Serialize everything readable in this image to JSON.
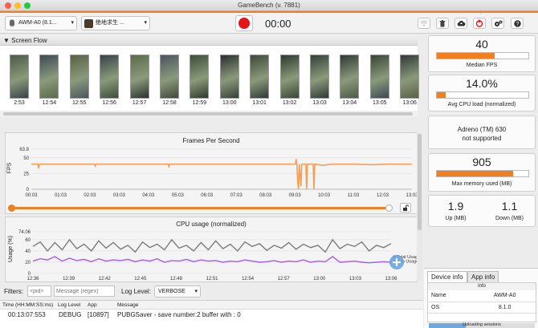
{
  "window": {
    "title": "GameBench (v. 7881)"
  },
  "toolbar": {
    "device": "AWM-A0 (8.1...",
    "app": "绝地求生 ...",
    "timer": "00:00"
  },
  "screen_flow": {
    "title": "Screen Flow",
    "times": [
      "2:53",
      "12:54",
      "12:55",
      "12:56",
      "12:57",
      "12:58",
      "12:59",
      "13:00",
      "13:01",
      "13:02",
      "13:03",
      "13:04",
      "13:05",
      "13:06"
    ]
  },
  "fps_chart": {
    "title": "Frames Per Second",
    "ylabel": "FPS"
  },
  "cpu_chart": {
    "title": "CPU usage (normalized)",
    "ylabel": "Usage (%)"
  },
  "chart_data": [
    {
      "type": "line",
      "title": "Frames Per Second",
      "ylabel": "FPS",
      "ylim": [
        0,
        63.8
      ],
      "yticks": [
        "63.8",
        "50",
        "25",
        "0"
      ],
      "xticks": [
        "00:03",
        "01:03",
        "02:03",
        "03:03",
        "04:03",
        "05:03",
        "06:03",
        "07:03",
        "08:03",
        "09:03",
        "10:03",
        "11:03",
        "12:03",
        "13:03"
      ],
      "series": [
        {
          "values": [
            [
              0,
              40
            ],
            [
              8,
              40
            ],
            [
              9,
              33
            ],
            [
              10,
              40
            ],
            [
              48,
              40
            ],
            [
              78,
              40
            ],
            [
              79,
              37
            ],
            [
              80,
              40
            ],
            [
              169,
              40
            ],
            [
              170,
              36
            ],
            [
              171,
              40
            ],
            [
              250,
              40
            ],
            [
              260,
              40
            ],
            [
              326,
              40
            ],
            [
              327,
              48
            ],
            [
              328,
              40
            ],
            [
              329,
              10
            ],
            [
              330,
              0
            ],
            [
              331,
              40
            ],
            [
              333,
              5
            ],
            [
              334,
              40
            ],
            [
              339,
              40
            ],
            [
              340,
              0
            ],
            [
              341,
              40
            ],
            [
              348,
              40
            ],
            [
              349,
              0
            ],
            [
              350,
              40
            ],
            [
              360,
              38
            ],
            [
              370,
              40
            ],
            [
              400,
              40
            ],
            [
              420,
              39
            ],
            [
              440,
              40
            ],
            [
              470,
              40
            ]
          ]
        }
      ]
    },
    {
      "type": "line",
      "title": "CPU usage (normalized)",
      "ylabel": "Usage (%)",
      "ylim": [
        0,
        74.06
      ],
      "yticks": [
        "74.06",
        "60",
        "40",
        "20",
        "0"
      ],
      "xticks": [
        "12:36",
        "12:39",
        "12:42",
        "12:45",
        "12:48",
        "12:51",
        "12:54",
        "12:57",
        "13:00",
        "13:03",
        "13:06"
      ],
      "series": [
        {
          "name": "Total Usage",
          "values": [
            48,
            56,
            40,
            55,
            42,
            60,
            44,
            52,
            40,
            58,
            45,
            55,
            43,
            50,
            38,
            56,
            46,
            52,
            42,
            60,
            45,
            50,
            40,
            55,
            42,
            58,
            44,
            52,
            40,
            56,
            48,
            53,
            41,
            50,
            45,
            55,
            43,
            52,
            46,
            50,
            38,
            60,
            44,
            52,
            48,
            56,
            40,
            50,
            46,
            53
          ]
        },
        {
          "name": "App Usage",
          "values": [
            22,
            26,
            24,
            30,
            22,
            27,
            23,
            25,
            21,
            26,
            22,
            24,
            23,
            25,
            21,
            24,
            22,
            26,
            20,
            23,
            22,
            25,
            21,
            24,
            22,
            23,
            20,
            22,
            21,
            24,
            22,
            20,
            21,
            23,
            20,
            22,
            21,
            24,
            20,
            22,
            21,
            30,
            20,
            21,
            22,
            20,
            19,
            20,
            21,
            20
          ]
        }
      ]
    }
  ],
  "filters": {
    "label": "Filters:",
    "pid_placeholder": "<pid>",
    "msg_placeholder": "Message (regex)",
    "loglevel_label": "Log Level:",
    "loglevel_value": "VERBOSE"
  },
  "log": {
    "headers": [
      "Time (HH:MM:SS:ms)",
      "Log Level",
      "App",
      "Message"
    ],
    "rows": [
      [
        "00:13:07:553",
        "DEBUG",
        "[10897]",
        "PUBGSaver - save number:2 buffer with : 0"
      ]
    ]
  },
  "metrics": {
    "median_fps": {
      "value": "40",
      "label": "Median FPS",
      "fraction": 0.63
    },
    "avg_cpu": {
      "value": "14.0%",
      "label": "Avg CPU load (normalized)",
      "fraction": 0.1
    },
    "gpu": {
      "line1": "Adreno (TM) 630",
      "line2": "not supported"
    },
    "max_memory": {
      "value": "905",
      "label": "Max memory used (MB)",
      "fraction": 0.83
    },
    "up": {
      "value": "1.9",
      "label": "Up (MB)"
    },
    "down": {
      "value": "1.1",
      "label": "Down (MB)"
    }
  },
  "info_panel": {
    "tabs": [
      "Device info",
      "App info"
    ],
    "header": "Info",
    "rows": [
      [
        "Name",
        "AWM-A0"
      ],
      [
        "OS",
        "8.1.0"
      ]
    ]
  },
  "status": {
    "text": "Uploading sessions",
    "fraction": 0.35
  },
  "colors": {
    "accent": "#f07f21",
    "record": "#e8121a",
    "cpu_total": "#7c7c7c",
    "cpu_app": "#a45cf0"
  }
}
